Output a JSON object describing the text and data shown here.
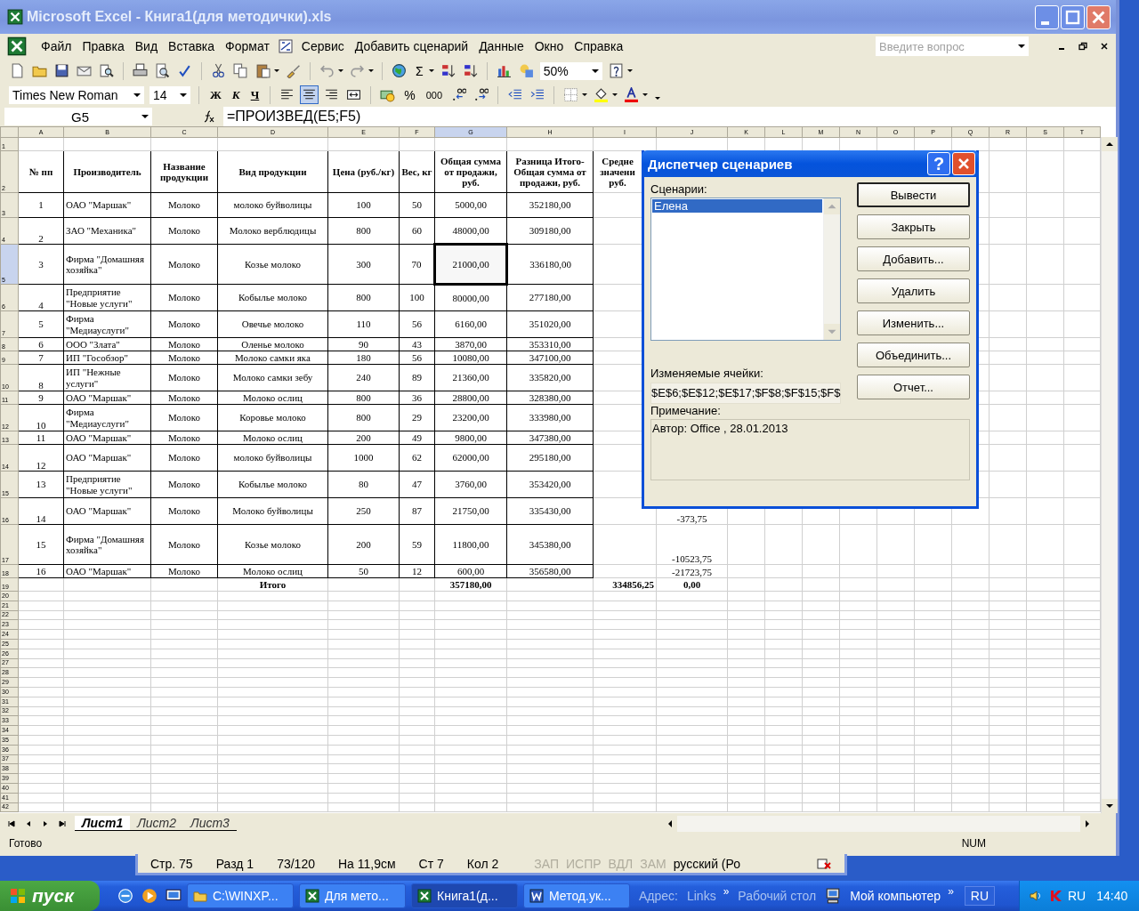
{
  "window": {
    "title": "Microsoft Excel - Книга1(для методички).xls"
  },
  "menu": [
    {
      "kind": "text",
      "label": "Файл"
    },
    {
      "kind": "text",
      "label": "Правка"
    },
    {
      "kind": "text",
      "label": "Вид"
    },
    {
      "kind": "text",
      "label": "Вставка"
    },
    {
      "kind": "text",
      "label": "Формат"
    },
    {
      "kind": "icon"
    },
    {
      "kind": "text",
      "label": "Сервис"
    },
    {
      "kind": "text",
      "label": "Добавить сценарий"
    },
    {
      "kind": "text",
      "label": "Данные"
    },
    {
      "kind": "text",
      "label": "Окно"
    },
    {
      "kind": "text",
      "label": "Справка"
    }
  ],
  "help_search": {
    "placeholder": "Введите вопрос"
  },
  "standard_toolbar": {
    "sum": "Σ",
    "zoom": "50%"
  },
  "formatting_toolbar": {
    "font": "Times New Roman",
    "size": "14",
    "style_buttons": [
      {
        "label": "Ж",
        "pressed": false
      },
      {
        "label": "К",
        "pressed": false
      },
      {
        "label": "Ч",
        "pressed": false
      }
    ],
    "alignment_buttons": [
      {
        "pressed": false
      },
      {
        "pressed": true
      },
      {
        "pressed": false
      }
    ],
    "percent": "%",
    "thousands": "000"
  },
  "formula_bar": {
    "name_box": "G5",
    "formula": "=ПРОИЗВЕД(E5;F5)"
  },
  "sheet": {
    "columns": [
      {
        "label": "A",
        "selected": false
      },
      {
        "label": "B",
        "selected": false
      },
      {
        "label": "C",
        "selected": false
      },
      {
        "label": "D",
        "selected": false
      },
      {
        "label": "E",
        "selected": false
      },
      {
        "label": "F",
        "selected": false
      },
      {
        "label": "G",
        "selected": true
      },
      {
        "label": "H",
        "selected": false
      },
      {
        "label": "I",
        "selected": false
      },
      {
        "label": "J",
        "selected": false
      },
      {
        "label": "K",
        "selected": false
      },
      {
        "label": "L",
        "selected": false
      },
      {
        "label": "M",
        "selected": false
      },
      {
        "label": "N",
        "selected": false
      },
      {
        "label": "O",
        "selected": false
      },
      {
        "label": "P",
        "selected": false
      },
      {
        "label": "Q",
        "selected": false
      },
      {
        "label": "R",
        "selected": false
      },
      {
        "label": "S",
        "selected": false
      },
      {
        "label": "T",
        "selected": false
      }
    ],
    "row_headers": [
      {
        "label": "1",
        "selected": false
      },
      {
        "label": "2",
        "selected": false
      },
      {
        "label": "3",
        "selected": false
      },
      {
        "label": "4",
        "selected": false
      },
      {
        "label": "5",
        "selected": true
      },
      {
        "label": "6",
        "selected": false
      },
      {
        "label": "7",
        "selected": false
      },
      {
        "label": "8",
        "selected": false
      },
      {
        "label": "9",
        "selected": false
      },
      {
        "label": "10",
        "selected": false
      },
      {
        "label": "11",
        "selected": false
      },
      {
        "label": "12",
        "selected": false
      },
      {
        "label": "13",
        "selected": false
      },
      {
        "label": "14",
        "selected": false
      },
      {
        "label": "15",
        "selected": false
      },
      {
        "label": "16",
        "selected": false
      },
      {
        "label": "17",
        "selected": false
      },
      {
        "label": "18",
        "selected": false
      },
      {
        "label": "19",
        "selected": false
      },
      {
        "label": "20",
        "selected": false
      },
      {
        "label": "21",
        "selected": false
      },
      {
        "label": "22",
        "selected": false
      },
      {
        "label": "23",
        "selected": false
      },
      {
        "label": "24",
        "selected": false
      },
      {
        "label": "25",
        "selected": false
      },
      {
        "label": "26",
        "selected": false
      },
      {
        "label": "27",
        "selected": false
      },
      {
        "label": "28",
        "selected": false
      },
      {
        "label": "29",
        "selected": false
      },
      {
        "label": "30",
        "selected": false
      },
      {
        "label": "31",
        "selected": false
      },
      {
        "label": "32",
        "selected": false
      },
      {
        "label": "33",
        "selected": false
      },
      {
        "label": "34",
        "selected": false
      },
      {
        "label": "35",
        "selected": false
      },
      {
        "label": "36",
        "selected": false
      },
      {
        "label": "37",
        "selected": false
      },
      {
        "label": "38",
        "selected": false
      },
      {
        "label": "39",
        "selected": false
      },
      {
        "label": "40",
        "selected": false
      },
      {
        "label": "41",
        "selected": false
      },
      {
        "label": "42",
        "selected": false
      }
    ]
  },
  "table": {
    "header": [
      "№ пп",
      "Производитель",
      "Название продукции",
      "Вид продукции",
      "Цена (руб./кг)",
      "Вес, кг",
      "Общая сумма от продажи, руб.",
      "Разница Итого-Общая сумма от продажи, руб.",
      "Средне значени руб."
    ],
    "rows": [
      {
        "selected": false,
        "cells": [
          "1",
          "ОАО \"Маршак\"",
          "Молоко",
          "молоко буйволицы",
          "100",
          "50",
          "5000,00",
          "352180,00"
        ]
      },
      {
        "selected": false,
        "cells": [
          "2",
          "ЗАО \"Механика\"",
          "Молоко",
          "Молоко верблюдицы",
          "800",
          "60",
          "48000,00",
          "309180,00"
        ]
      },
      {
        "selected": true,
        "cells": [
          "3",
          "Фирма \"Домашняя хозяйка\"",
          "Молоко",
          "Козье молоко",
          "300",
          "70",
          "21000,00",
          "336180,00"
        ]
      },
      {
        "selected": false,
        "cells": [
          "4",
          "Предприятие \"Новые услуги\"",
          "Молоко",
          "Кобылье молоко",
          "800",
          "100",
          "80000,00",
          "277180,00"
        ]
      },
      {
        "selected": false,
        "cells": [
          "5",
          "Фирма \"Медиауслуги\"",
          "Молоко",
          "Овечье молоко",
          "110",
          "56",
          "6160,00",
          "351020,00"
        ]
      },
      {
        "selected": false,
        "cells": [
          "6",
          "ООО \"Злата\"",
          "Молоко",
          "Оленье молоко",
          "90",
          "43",
          "3870,00",
          "353310,00"
        ]
      },
      {
        "selected": false,
        "cells": [
          "7",
          "ИП \"Гособзор\"",
          "Молоко",
          "Молоко самки яка",
          "180",
          "56",
          "10080,00",
          "347100,00"
        ]
      },
      {
        "selected": false,
        "cells": [
          "8",
          "ИП \"Нежные услуги\"",
          "Молоко",
          "Молоко самки зебу",
          "240",
          "89",
          "21360,00",
          "335820,00"
        ]
      },
      {
        "selected": false,
        "cells": [
          "9",
          "ОАО \"Маршак\"",
          "Молоко",
          "Молоко ослиц",
          "800",
          "36",
          "28800,00",
          "328380,00"
        ]
      },
      {
        "selected": false,
        "cells": [
          "10",
          "Фирма \"Медиауслуги\"",
          "Молоко",
          "Коровье молоко",
          "800",
          "29",
          "23200,00",
          "333980,00"
        ]
      },
      {
        "selected": false,
        "cells": [
          "11",
          "ОАО \"Маршак\"",
          "Молоко",
          "Молоко ослиц",
          "200",
          "49",
          "9800,00",
          "347380,00"
        ]
      },
      {
        "selected": false,
        "cells": [
          "12",
          "ОАО \"Маршак\"",
          "Молоко",
          "молоко буйволицы",
          "1000",
          "62",
          "62000,00",
          "295180,00"
        ]
      },
      {
        "selected": false,
        "cells": [
          "13",
          "Предприятие \"Новые услуги\"",
          "Молоко",
          "Кобылье молоко",
          "80",
          "47",
          "3760,00",
          "353420,00"
        ]
      },
      {
        "selected": false,
        "cells": [
          "14",
          "ОАО \"Маршак\"",
          "Молоко",
          "Молоко буйволицы",
          "250",
          "87",
          "21750,00",
          "335430,00"
        ],
        "column_j": "-373,75"
      },
      {
        "selected": false,
        "cells": [
          "15",
          "Фирма \"Домашняя хозяйка\"",
          "Молоко",
          "Козье молоко",
          "200",
          "59",
          "11800,00",
          "345380,00"
        ],
        "column_j": "-10523,75"
      },
      {
        "selected": false,
        "cells": [
          "16",
          "ОАО \"Маршак\"",
          "Молоко",
          "Молоко ослиц",
          "50",
          "12",
          "600,00",
          "356580,00"
        ],
        "column_j": "-21723,75"
      }
    ],
    "total": {
      "label": "Итого",
      "sales_total": "357180,00",
      "column_i": "334856,25",
      "column_j": "0,00"
    }
  },
  "dialog": {
    "title": "Диспетчер сценариев",
    "help": "?",
    "scenarios_label": "Сценарии:",
    "scenarios": [
      {
        "label": "Елена",
        "selected": true
      }
    ],
    "changing_cells_label": "Изменяемые ячейки:",
    "changing_cells": "$E$6;$E$12;$E$17;$F$8;$F$15;$F$",
    "comment_label": "Примечание:",
    "comment": "Автор: Office , 28.01.2013",
    "buttons": [
      {
        "label": "Вывести",
        "default": true
      },
      {
        "label": "Закрыть",
        "default": false
      },
      {
        "label": "Добавить...",
        "default": false
      },
      {
        "label": "Удалить",
        "default": false
      },
      {
        "label": "Изменить...",
        "default": false
      },
      {
        "label": "Объединить...",
        "default": false
      },
      {
        "label": "Отчет...",
        "default": false
      }
    ]
  },
  "sheet_tabs": [
    {
      "label": "Лист1",
      "selected": true
    },
    {
      "label": "Лист2",
      "selected": false
    },
    {
      "label": "Лист3",
      "selected": false
    }
  ],
  "status_bar": {
    "text": "Готово",
    "num": "NUM"
  },
  "background_window_status": [
    {
      "text": "Стр. 75",
      "disabled": false
    },
    {
      "text": "Разд 1",
      "disabled": false
    },
    {
      "text": "73/120",
      "disabled": false
    },
    {
      "text": "На 11,9см",
      "disabled": false
    },
    {
      "text": "Ст 7",
      "disabled": false
    },
    {
      "text": "Кол 2",
      "disabled": false
    },
    {
      "text": "ЗАП",
      "disabled": true
    },
    {
      "text": "ИСПР",
      "disabled": true
    },
    {
      "text": "ВДЛ",
      "disabled": true
    },
    {
      "text": "ЗАМ",
      "disabled": true
    },
    {
      "text": "русский (Ро",
      "disabled": false
    }
  ],
  "taskbar": {
    "start": "пуск",
    "tasks": [
      {
        "kind": "folder",
        "label": "C:\\WINXP...",
        "selected": false
      },
      {
        "kind": "excel",
        "label": "Для мето...",
        "selected": false
      },
      {
        "kind": "excel",
        "label": "Книга1(д...",
        "selected": true
      },
      {
        "kind": "word",
        "label": "Метод.ук...",
        "selected": false
      }
    ],
    "address_label": "Адрес:",
    "links": "Links",
    "more": "»",
    "desktop": "Рабочий стол",
    "computer": "Мой компьютер",
    "more_2": "»",
    "language": "RU",
    "tray_language": "RU",
    "clock": "14:40"
  }
}
